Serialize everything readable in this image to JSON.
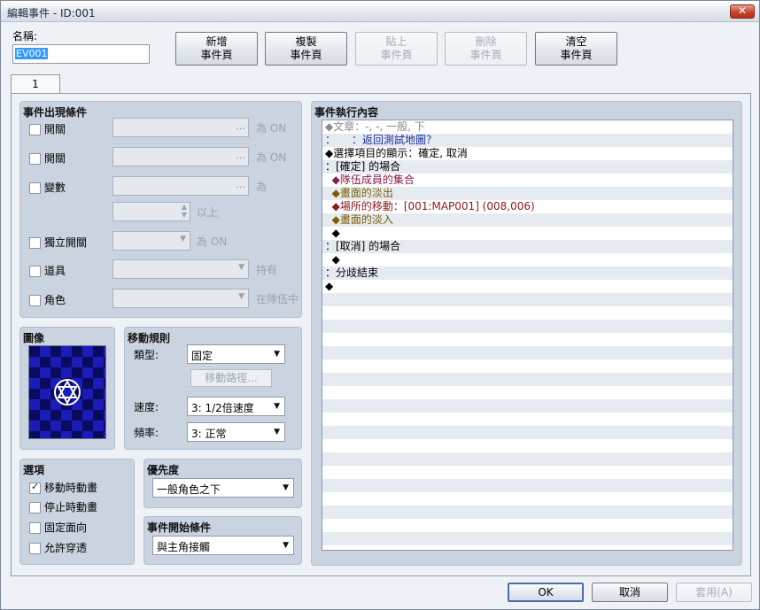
{
  "window": {
    "title": "編輯事件 - ID:001",
    "close_label": "✕"
  },
  "name": {
    "label": "名稱:",
    "value": "EV001"
  },
  "toolbar": [
    {
      "label": "新增\n事件頁",
      "enabled": true
    },
    {
      "label": "複製\n事件頁",
      "enabled": true
    },
    {
      "label": "貼上\n事件頁",
      "enabled": false
    },
    {
      "label": "刪除\n事件頁",
      "enabled": false
    },
    {
      "label": "清空\n事件頁",
      "enabled": true
    }
  ],
  "tabs": [
    {
      "label": "1"
    }
  ],
  "conditions": {
    "title": "事件出現條件",
    "switch1": {
      "label": "開關",
      "suffix": "為 ON",
      "checked": false
    },
    "switch2": {
      "label": "開關",
      "suffix": "為 ON",
      "checked": false
    },
    "variable": {
      "label": "變數",
      "suffix": "為",
      "checked": false,
      "above_suffix": "以上"
    },
    "self_switch": {
      "label": "獨立開關",
      "suffix": "為 ON",
      "checked": false
    },
    "item": {
      "label": "道具",
      "suffix": "持有",
      "checked": false
    },
    "actor": {
      "label": "角色",
      "suffix": "在隊伍中",
      "checked": false
    }
  },
  "image": {
    "title": "圖像",
    "icon": "hexagram-icon"
  },
  "movement": {
    "title": "移動規則",
    "type_label": "類型:",
    "type_value": "固定",
    "route_button": "移動路徑...",
    "speed_label": "速度:",
    "speed_value": "3: 1/2倍速度",
    "freq_label": "頻率:",
    "freq_value": "3: 正常"
  },
  "options": {
    "title": "選項",
    "items": [
      {
        "label": "移動時動畫",
        "checked": true
      },
      {
        "label": "停止時動畫",
        "checked": false
      },
      {
        "label": "固定面向",
        "checked": false
      },
      {
        "label": "允許穿透",
        "checked": false
      }
    ]
  },
  "priority": {
    "title": "優先度",
    "value": "一般角色之下"
  },
  "trigger": {
    "title": "事件開始條件",
    "value": "與主角接觸"
  },
  "contents": {
    "title": "事件執行內容",
    "lines": [
      {
        "text": "◆文章：-, -, 一般, 下",
        "style": "g"
      },
      {
        "text": "：　　：返回測試地圖？",
        "style": "b"
      },
      {
        "text": "◆選擇項目的顯示：確定, 取消",
        "style": "k"
      },
      {
        "text": "：[確定] 的場合",
        "style": "k"
      },
      {
        "text": "  ◆隊伍成員的集合",
        "style": "m"
      },
      {
        "text": "  ◆畫面的淡出",
        "style": "o"
      },
      {
        "text": "  ◆場所的移動：[001:MAP001] (008,006)",
        "style": "r"
      },
      {
        "text": "  ◆畫面的淡入",
        "style": "o"
      },
      {
        "text": "  ◆",
        "style": "k"
      },
      {
        "text": "：[取消] 的場合",
        "style": "k"
      },
      {
        "text": "  ◆",
        "style": "k"
      },
      {
        "text": "：分歧結束",
        "style": "k"
      },
      {
        "text": "◆",
        "style": "k"
      }
    ],
    "total_rows": 32
  },
  "buttons": {
    "ok": "OK",
    "cancel": "取消",
    "apply": "套用(A)"
  }
}
